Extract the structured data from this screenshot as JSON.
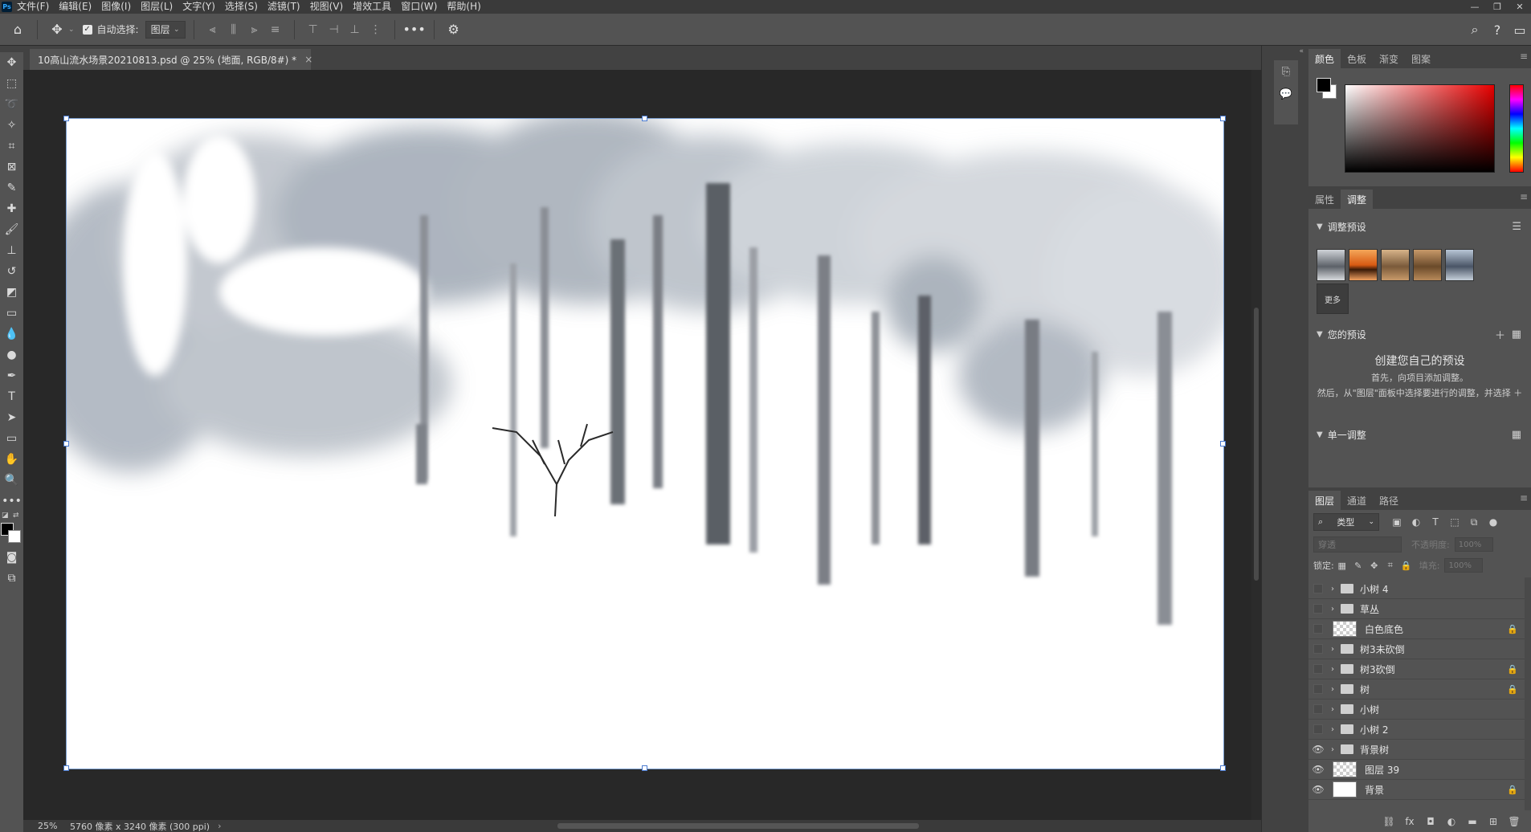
{
  "menubar": {
    "logo": "Ps",
    "items": [
      "文件(F)",
      "编辑(E)",
      "图像(I)",
      "图层(L)",
      "文字(Y)",
      "选择(S)",
      "滤镜(T)",
      "视图(V)",
      "增效工具",
      "窗口(W)",
      "帮助(H)"
    ]
  },
  "options": {
    "auto_select_label": "自动选择:",
    "auto_select_target": "图层"
  },
  "document": {
    "tab_title": "10高山流水场景20210813.psd @ 25% (地面, RGB/8#) *",
    "close_glyph": "×"
  },
  "status": {
    "zoom": "25%",
    "info": "5760 像素 x 3240 像素 (300 ppi)"
  },
  "color_panel": {
    "tabs": [
      "颜色",
      "色板",
      "渐变",
      "图案"
    ],
    "foreground": "#000000",
    "background": "#ffffff"
  },
  "adjust_panel": {
    "tabs": [
      "属性",
      "调整"
    ],
    "presets_header": "调整预设",
    "more_label": "更多",
    "your_presets_header": "您的预设",
    "create_title": "创建您自己的预设",
    "tip_line1": "首先，向项目添加调整。",
    "tip_line2": "然后，从\"图层\"面板中选择要进行的调整，并选择 ＋",
    "single_adjust_header": "单一调整"
  },
  "layers_panel": {
    "tabs": [
      "图层",
      "通道",
      "路径"
    ],
    "kind_label": "类型",
    "blend_mode": "穿透",
    "opacity_label": "不透明度:",
    "opacity_value": "100%",
    "lock_label": "锁定:",
    "fill_label": "填充:",
    "fill_value": "100%",
    "layers": [
      {
        "name": "小树 4",
        "type": "group",
        "visible": false,
        "locked": false
      },
      {
        "name": "草丛",
        "type": "group",
        "visible": false,
        "locked": false
      },
      {
        "name": "白色底色",
        "type": "pixel",
        "visible": false,
        "locked": true
      },
      {
        "name": "树3未砍倒",
        "type": "group",
        "visible": false,
        "locked": false
      },
      {
        "name": "树3砍倒",
        "type": "group",
        "visible": false,
        "locked": true
      },
      {
        "name": "树",
        "type": "group",
        "visible": false,
        "locked": true
      },
      {
        "name": "小树",
        "type": "group",
        "visible": false,
        "locked": false
      },
      {
        "name": "小树 2",
        "type": "group",
        "visible": false,
        "locked": false
      },
      {
        "name": "背景树",
        "type": "group",
        "visible": true,
        "locked": false
      },
      {
        "name": "图层 39",
        "type": "pixel",
        "visible": true,
        "locked": false
      },
      {
        "name": "背景",
        "type": "background",
        "visible": true,
        "locked": true
      }
    ]
  }
}
